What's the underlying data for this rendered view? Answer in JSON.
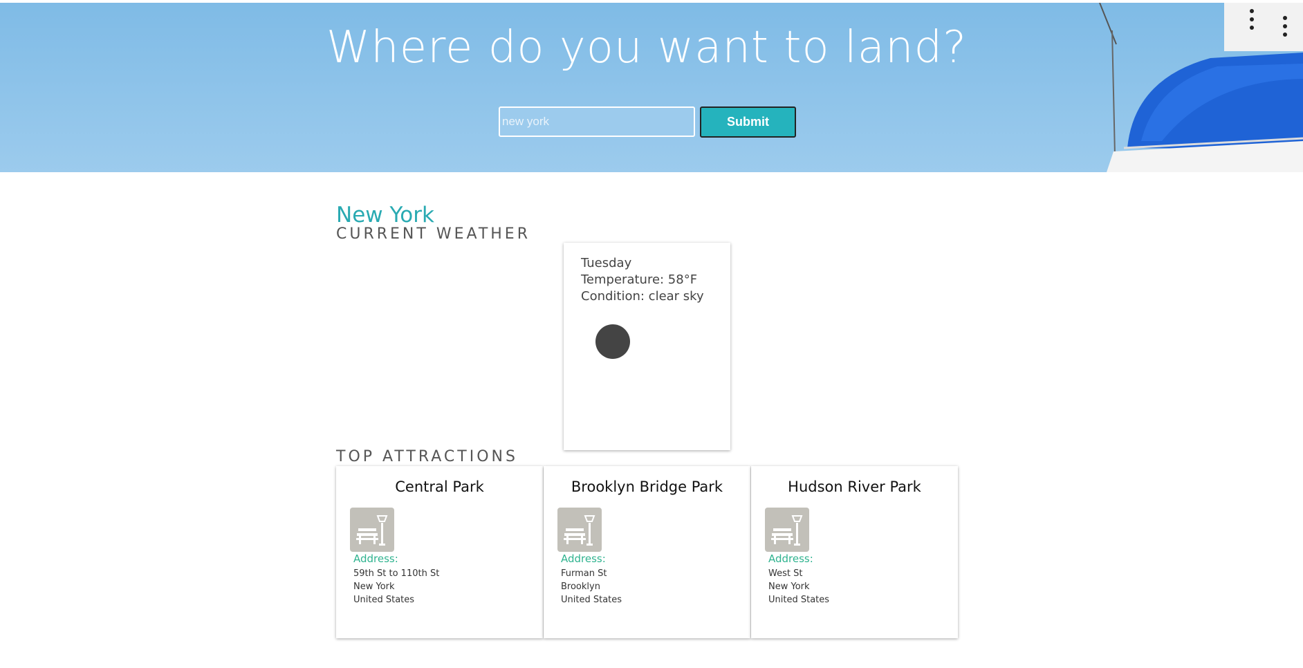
{
  "hero": {
    "title": "Where do you want to land?",
    "search_value": "new york",
    "submit_label": "Submit"
  },
  "city": {
    "name": "New York"
  },
  "weather": {
    "heading": "CURRENT WEATHER",
    "day": "Tuesday",
    "temperature": "Temperature: 58°F",
    "condition": "Condition: clear sky"
  },
  "attractions": {
    "heading": "TOP ATTRACTIONS",
    "address_label": "Address:",
    "items": [
      {
        "name": "Central Park",
        "line1": "59th St to 110th St",
        "line2": "New York",
        "line3": "United States"
      },
      {
        "name": "Brooklyn Bridge Park",
        "line1": "Furman St",
        "line2": "Brooklyn",
        "line3": "United States"
      },
      {
        "name": "Hudson River Park",
        "line1": "West St",
        "line2": "New York",
        "line3": "United States"
      }
    ]
  },
  "colors": {
    "accent": "#29aab2",
    "submit": "#25b3bd",
    "address": "#2fb38f",
    "sky": "#8cc4ea"
  },
  "icons": {
    "attraction": "park-bench-lamp-icon",
    "weather": "weather-condition-icon"
  }
}
